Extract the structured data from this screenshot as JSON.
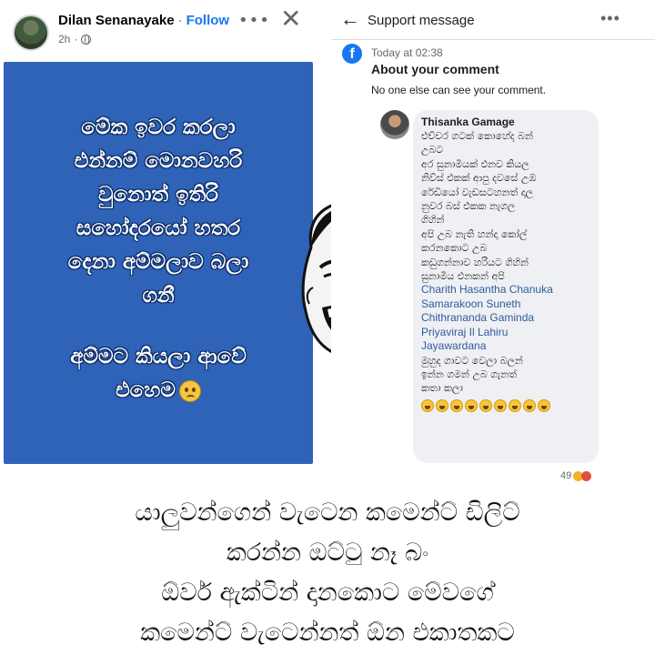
{
  "post": {
    "author": "Dilan Senanayake",
    "separator": "·",
    "follow_label": "Follow",
    "time": "2h",
    "privacy_icon": "globe-icon",
    "more_icon": "•••",
    "close_icon": "✕",
    "card_color": "#2e63b8",
    "card_lines_1": [
      "මේක ඉවර කරලා",
      "එන්නම් මොනවහරි",
      "වුනොත් ඉතිරි",
      "සහෝදරයෝ හතර",
      "දෙනා අම්මලාව බලා",
      "ගනී"
    ],
    "card_lines_2": [
      "අම්මට කියලා ආවේ",
      "එහෙම"
    ]
  },
  "support": {
    "back_icon": "←",
    "title": "Support message",
    "more_icon": "•••",
    "logo_letter": "f",
    "time": "Today at 02:38",
    "about_title": "About your comment",
    "about_subtitle": "No one else can see your comment.",
    "comment": {
      "author": "Thisanka Gamage",
      "lines": [
        "එච්චර ගටක් කොහේද බන්",
        "උබට",
        "අර සුනාමියක් එනව කියල",
        "නිව්ස් එකක් ආපු දවසේ උඹ",
        "රේඩියෝ වැඩසටහනත් දාල",
        "නුවර බස් එකක නැගල",
        "ගිහින්",
        "අපි උබ නැති හන්දා කෝල්",
        "කරනකොට උබ",
        "කඩුගන්නාව හරියට ගිහින්",
        "සුනාමිය එනකන් අපි"
      ],
      "tags": [
        "Charith Hasantha Chanuka",
        "Samarakoon Suneth",
        "Chithrananda Gaminda",
        "Priyaviraj Il Lahiru",
        "Jayawardana"
      ],
      "lines_after": [
        "මුහුද ගාවට වෙලා බලන්",
        "ඉන්න ගමන් උබ ගැනත්",
        "කතා කලා"
      ],
      "laugh_count": 9
    },
    "reaction_count": "49"
  },
  "caption": {
    "lines": [
      "යාලුවන්ගෙන් වැටෙන කමෙන්ට් ඩිලිට්",
      "කරන්න ඔට්ටු නෑ බං",
      "ඕවර් ඇක්ටින් දානකොට මේවගේ",
      "කමෙන්ට් වැටෙන්නත් ඕන එකාතකට"
    ]
  }
}
